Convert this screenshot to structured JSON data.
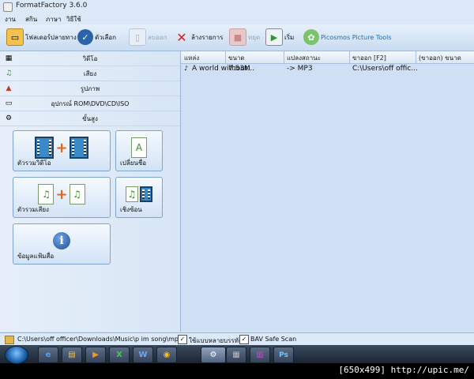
{
  "window": {
    "title": "FormatFactory 3.6.0"
  },
  "menu": [
    "งาน",
    "สกิน",
    "ภาษา",
    "วิธีใช้"
  ],
  "toolbar": [
    {
      "label": "โฟลเดอร์ปลายทาง",
      "icon": "folder-icon",
      "enabled": true
    },
    {
      "label": "ตัวเลือก",
      "icon": "options-icon",
      "enabled": true
    },
    {
      "label": "ลบออก",
      "icon": "remove-icon",
      "enabled": false
    },
    {
      "label": "ล้างรายการ",
      "icon": "clear-list-icon",
      "enabled": true
    },
    {
      "label": "หยุด",
      "icon": "stop-icon",
      "enabled": false
    },
    {
      "label": "เริ่ม",
      "icon": "start-icon",
      "enabled": true
    },
    {
      "label": "Picosmos Picture Tools",
      "icon": "picosmos-icon",
      "enabled": true
    }
  ],
  "sidebar": {
    "categories": [
      {
        "label": "วิดีโอ",
        "icon": "video-icon"
      },
      {
        "label": "เสียง",
        "icon": "audio-icon"
      },
      {
        "label": "รูปภาพ",
        "icon": "picture-icon"
      },
      {
        "label": "อุปกรณ์ ROM\\DVD\\CD\\ISO",
        "icon": "rom-device-icon"
      },
      {
        "label": "ขั้นสูง",
        "icon": "advanced-icon"
      }
    ],
    "tools": [
      {
        "label": "ตัวรวมวิดีโอ",
        "icon": "video-joiner-icon"
      },
      {
        "label": "เปลี่ยนชื่อ",
        "icon": "rename-icon"
      },
      {
        "label": "ตัวรวมเสียง",
        "icon": "audio-joiner-icon"
      },
      {
        "label": "เชิงซ้อน",
        "icon": "mux-icon"
      },
      {
        "label": "ข้อมูลแฟ้มสื่อ",
        "icon": "media-info-icon"
      }
    ]
  },
  "table": {
    "columns": [
      "แหล่ง",
      "ขนาด",
      "แปลงสถานะ",
      "ขาออก [F2]",
      "(ขาออก) ขนาด"
    ],
    "rows": [
      {
        "source": "A world without...",
        "size": "7.53M",
        "status": "-> MP3",
        "output": "C:\\Users\\off offic...",
        "out_size": ""
      }
    ]
  },
  "statusbar": {
    "path": "C:\\Users\\off officer\\Downloads\\Music\\p im song\\mp3",
    "multithread_label": "ใช้แบบหลายบรรทัด",
    "bav_label": "BAV Safe Scan"
  },
  "taskbar": {
    "items": [
      "ie-icon",
      "explorer-icon",
      "media-icon",
      "excel-icon",
      "word-icon",
      "chrome-icon",
      "formatfactory-icon",
      "cmd-icon",
      "winrar-icon",
      "photoshop-icon"
    ],
    "glyphs": [
      "e",
      "▤",
      "▶",
      "X",
      "W",
      "◉",
      "⚙",
      "▦",
      "▥",
      "Ps"
    ]
  },
  "watermark": "[650x499] http://upic.me/",
  "colors": {
    "accent": "#3a8ac9",
    "plus": "#e2661a",
    "start_green": "#2a9a2a"
  }
}
